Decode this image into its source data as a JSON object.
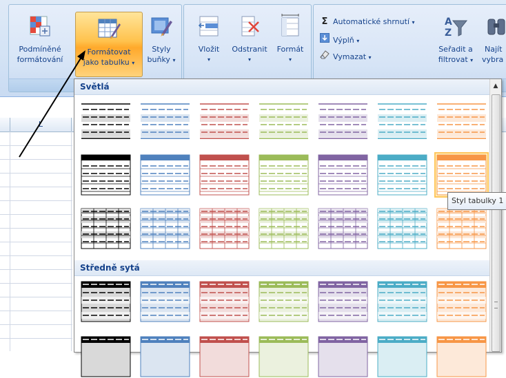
{
  "ribbon": {
    "conditional_format": {
      "line1": "Podmíněné",
      "line2": "formátování"
    },
    "format_table": {
      "line1": "Formátovat",
      "line2": "jako tabulku"
    },
    "cell_styles": {
      "line1": "Styly",
      "line2": "buňky"
    },
    "insert_label": "Vložit",
    "delete_label": "Odstranit",
    "format_label": "Formát",
    "autosum_label": "Automatické shrnutí",
    "fill_label": "Výplň",
    "clear_label": "Vymazat",
    "sort_filter": {
      "line1": "Seřadit a",
      "line2": "filtrovat"
    },
    "find_select": {
      "line1": "Najít",
      "line2": "vybra"
    },
    "dropdown_arrow": "▾",
    "sigma_glyph": "Σ"
  },
  "sheet": {
    "column_label": "L"
  },
  "gallery": {
    "section_light": "Světlá",
    "section_medium": "Středně sytá",
    "tooltip": "Styl tabulky 1",
    "colors": [
      "#000000",
      "#4f81bd",
      "#c0504d",
      "#9bbb59",
      "#8064a2",
      "#4bacc6",
      "#f79646"
    ],
    "fills": [
      "#d9d9d9",
      "#dbe5f1",
      "#f2dcdb",
      "#ebf1de",
      "#e5e0ec",
      "#daeef3",
      "#fde9d9"
    ],
    "highlighted_index": 6
  },
  "icons": {
    "scroll_up": "▲",
    "grip": "≡"
  }
}
